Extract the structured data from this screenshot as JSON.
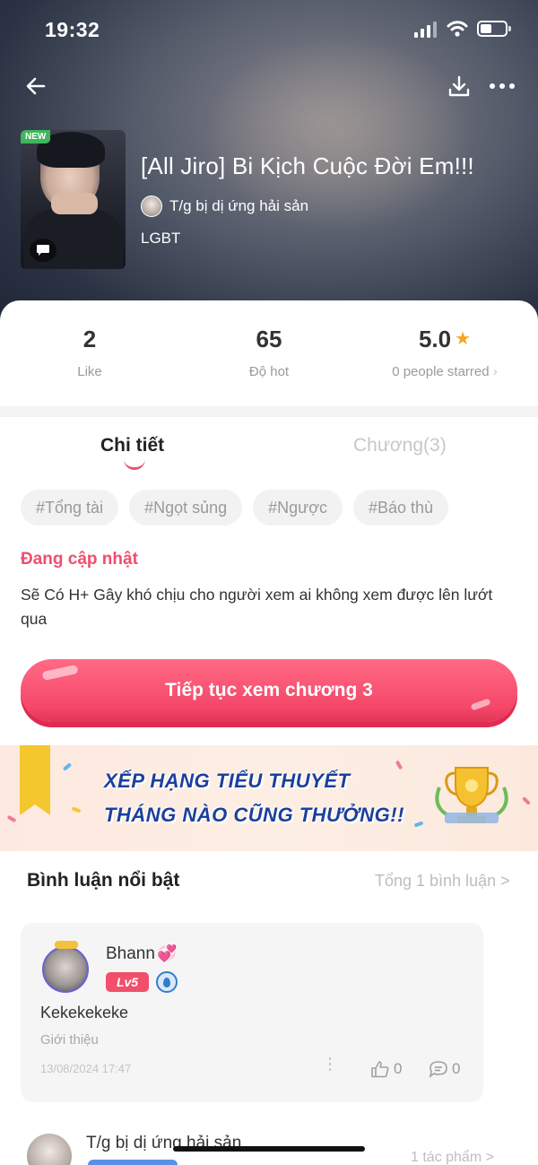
{
  "status_bar": {
    "time": "19:32"
  },
  "header": {
    "new_badge": "NEW",
    "title": "[All Jiro] Bi Kịch Cuộc Đời Em!!!",
    "author": "T/g bị dị ứng hải sản",
    "category": "LGBT",
    "icons": [
      "back-arrow-icon",
      "download-icon",
      "more-icon",
      "comment-icon"
    ]
  },
  "stats": {
    "like": {
      "value": "2",
      "label": "Like"
    },
    "hot": {
      "value": "65",
      "label": "Độ hot"
    },
    "rating": {
      "value": "5.0",
      "label": "0 people starred",
      "star_color": "#F4A623"
    }
  },
  "tabs": [
    {
      "label": "Chi tiết",
      "active": true
    },
    {
      "label": "Chương(3)",
      "active": false
    }
  ],
  "tags": [
    "#Tổng tài",
    "#Ngọt sủng",
    "#Ngược",
    "#Báo thù"
  ],
  "status": "Đang cập nhật",
  "description": "Sẽ Có H+ Gây khó chịu cho người xem ai không xem được lên lướt qua",
  "cta": {
    "label": "Tiếp tục xem chương 3",
    "color": "#F5486A"
  },
  "banner": {
    "line1": "XẾP HẠNG TIỂU THUYẾT",
    "line2": "THÁNG NÀO CŨNG THƯỞNG!!"
  },
  "comments": {
    "title": "Bình luận nổi bật",
    "total": "Tổng 1 bình luận >",
    "items": [
      {
        "name": "Bhann",
        "level": "Lv5",
        "text": "Kekekekeke",
        "sub": "Giới thiệu",
        "date": "13/08/2024 17:47",
        "likes": "0",
        "replies": "0"
      }
    ]
  },
  "author_footer": {
    "name": "T/g bị dị ứng hải sản",
    "works": "1 tác phẩm >"
  },
  "colors": {
    "accent": "#EF4E6E",
    "banner_text": "#1B3F9C"
  }
}
